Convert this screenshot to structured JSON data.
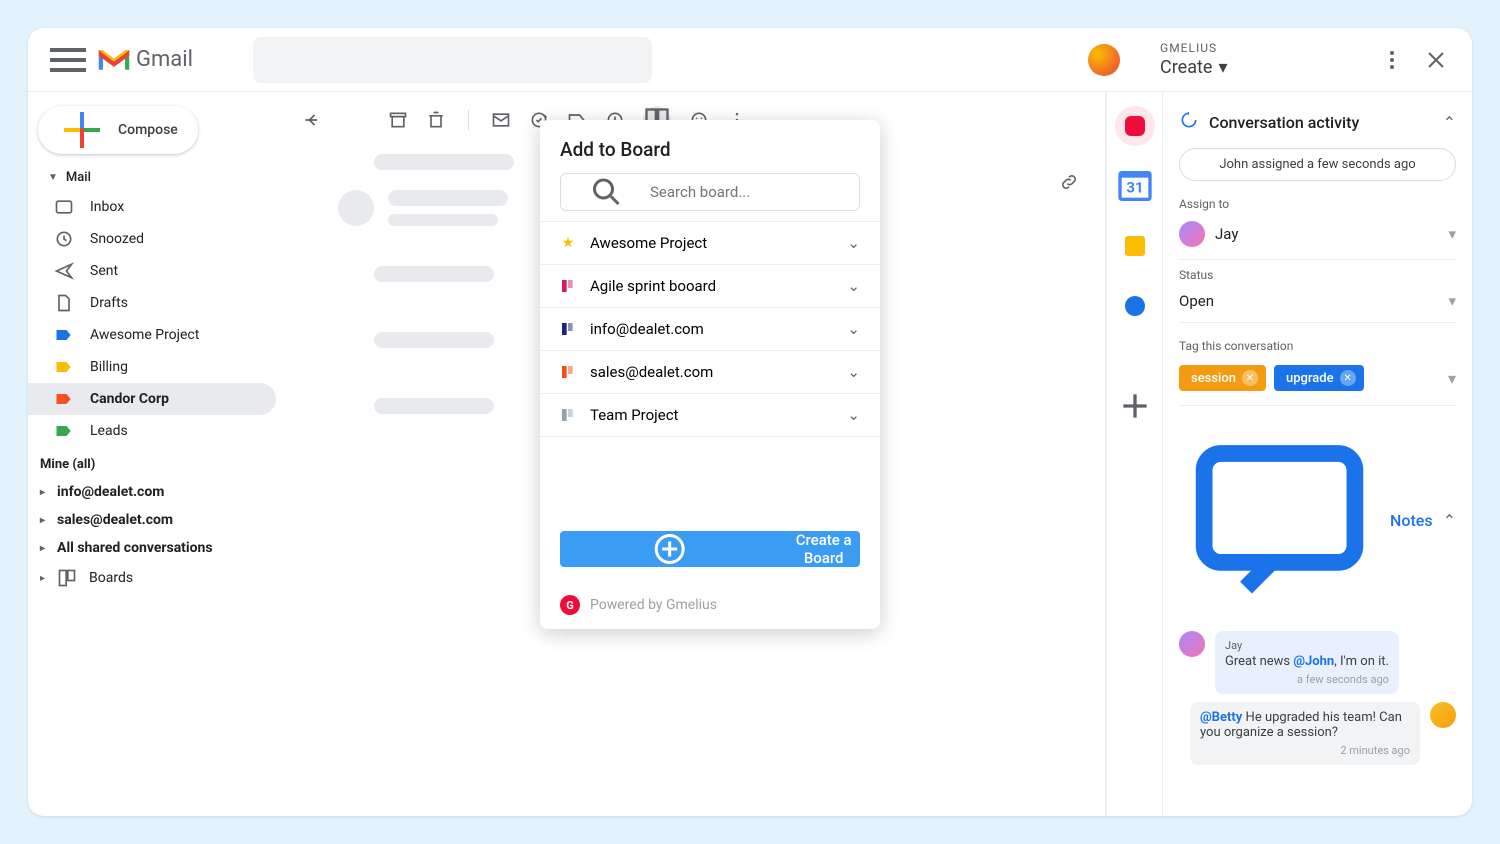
{
  "header": {
    "app_name": "Gmail",
    "gmelius_brand": "GMELIUS",
    "gmelius_action": "Create"
  },
  "compose": {
    "label": "Compose"
  },
  "sidebar": {
    "mail_label": "Mail",
    "items": [
      {
        "label": "Inbox"
      },
      {
        "label": "Snoozed"
      },
      {
        "label": "Sent"
      },
      {
        "label": "Drafts"
      },
      {
        "label": "Awesome Project"
      },
      {
        "label": "Billing"
      },
      {
        "label": "Candor Corp"
      },
      {
        "label": "Leads"
      }
    ],
    "mine_label": "Mine (all)",
    "accounts": [
      {
        "label": "info@dealet.com"
      },
      {
        "label": "sales@dealet.com"
      },
      {
        "label": "All shared conversations"
      }
    ],
    "boards_label": "Boards"
  },
  "popup": {
    "title": "Add to Board",
    "search_placeholder": "Search board...",
    "boards": [
      {
        "label": "Awesome Project",
        "color": "#fbbc04",
        "star": true
      },
      {
        "label": "Agile sprint booard",
        "color": "#d81b60"
      },
      {
        "label": "info@dealet.com",
        "color": "#1a237e"
      },
      {
        "label": "sales@dealet.com",
        "color": "#f4511e"
      },
      {
        "label": "Team Project",
        "color": "#90a4ae"
      }
    ],
    "create_label": "Create a Board",
    "powered": "Powered by Gmelius"
  },
  "panel": {
    "activity_title": "Conversation activity",
    "activity_text": "John assigned a few seconds ago",
    "assign_label": "Assign to",
    "assignee": "Jay",
    "status_label": "Status",
    "status_value": "Open",
    "tag_label": "Tag this conversation",
    "tags": [
      {
        "label": "session",
        "color": "#f39c12"
      },
      {
        "label": "upgrade",
        "color": "#1a73e8"
      }
    ],
    "notes_title": "Notes",
    "notes": [
      {
        "author": "Jay",
        "prefix": "Great news ",
        "mention": "@John",
        "suffix": ", I'm on it.",
        "time": "a few seconds ago"
      },
      {
        "mention": "@Betty",
        "suffix": " He upgraded his team! Can you organize a session?",
        "time": "2 minutes ago"
      }
    ]
  }
}
